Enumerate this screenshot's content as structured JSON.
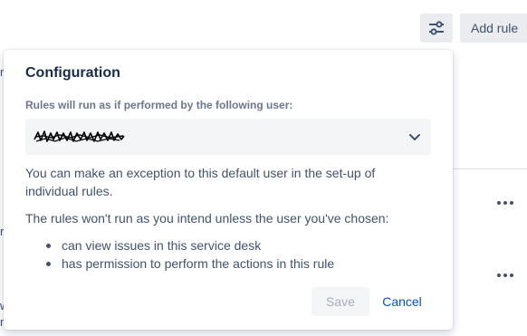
{
  "toolbar": {
    "filter_icon": "sliders-icon",
    "add_rule_label": "Add rule"
  },
  "background": {
    "frag_top": "n",
    "frag_mid": "r",
    "frag_bottom_1": "w",
    "frag_bottom_2": "n"
  },
  "config": {
    "title": "Configuration",
    "user_label": "Rules will run as if performed by the following user:",
    "selected_user_redacted": true,
    "exception_text": "You can make an exception to this default user in the set-up of individual rules.",
    "warning_text": "The rules won't run as you intend unless the user you've chosen:",
    "requirements": [
      "can view issues in this service desk",
      "has permission to perform the actions in this rule"
    ],
    "save_label": "Save",
    "cancel_label": "Cancel"
  },
  "colors": {
    "heading": "#172b4d",
    "body": "#42526e",
    "label": "#6b778c",
    "link": "#0052cc",
    "button_bg": "#ebecf0",
    "disabled_text": "#a5adba"
  }
}
